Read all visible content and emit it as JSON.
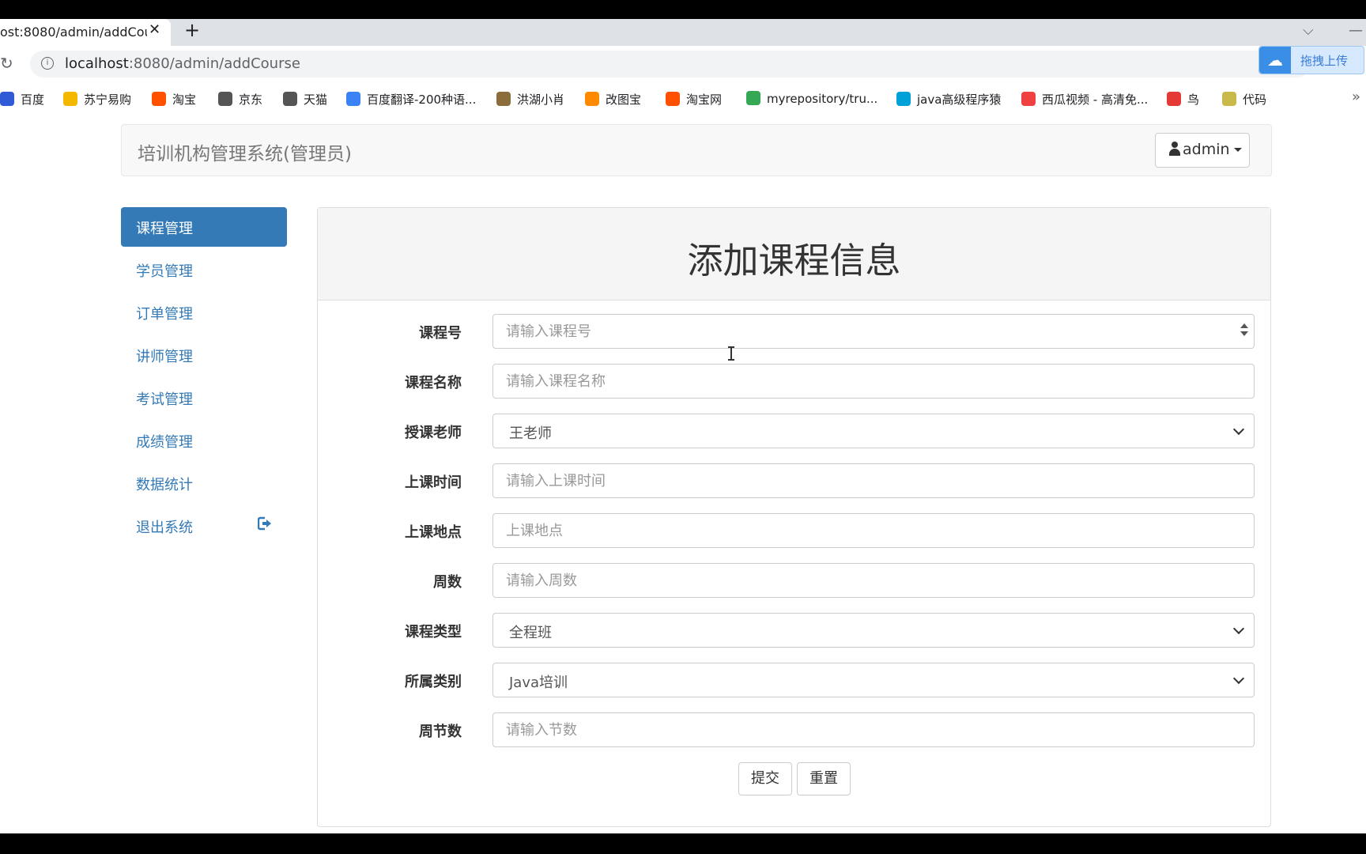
{
  "browser": {
    "tab_title": "ost:8080/admin/addCou",
    "url_host": "localhost",
    "url_rest": ":8080/admin/addCourse",
    "upload_label": "拖拽上传",
    "bookmarks": [
      {
        "label": "百度",
        "icon": "baidu-paw-icon",
        "color": "#2f5bd6"
      },
      {
        "label": "苏宁易购",
        "icon": "suning-lion-icon",
        "color": "#f5b800"
      },
      {
        "label": "淘宝",
        "icon": "taobao-icon",
        "color": "#ff5000"
      },
      {
        "label": "京东",
        "icon": "globe-icon",
        "color": "#555555"
      },
      {
        "label": "天猫",
        "icon": "globe-icon",
        "color": "#555555"
      },
      {
        "label": "百度翻译-200种语...",
        "icon": "translate-icon",
        "color": "#3b82f6"
      },
      {
        "label": "洪湖小肖",
        "icon": "bird-icon",
        "color": "#8a6d3b"
      },
      {
        "label": "改图宝",
        "icon": "gaitubao-icon",
        "color": "#ff8a00"
      },
      {
        "label": "淘宝网",
        "icon": "taobao-icon",
        "color": "#ff5000"
      },
      {
        "label": "myrepository/tru...",
        "icon": "chrome-icon",
        "color": "#34a853"
      },
      {
        "label": "java高级程序猿",
        "icon": "bilibili-icon",
        "color": "#00a1d6"
      },
      {
        "label": "西瓜视频 - 高清免...",
        "icon": "xigua-icon",
        "color": "#f04142"
      },
      {
        "label": "鸟",
        "icon": "bird-red-icon",
        "color": "#e53935"
      },
      {
        "label": "代码",
        "icon": "code-icon",
        "color": "#c9b84a"
      }
    ],
    "more": "»"
  },
  "navbar": {
    "brand": "培训机构管理系统(管理员)",
    "user": "admin"
  },
  "sidebar": {
    "items": [
      {
        "label": "课程管理",
        "active": true
      },
      {
        "label": "学员管理"
      },
      {
        "label": "订单管理"
      },
      {
        "label": "讲师管理"
      },
      {
        "label": "考试管理"
      },
      {
        "label": "成绩管理"
      },
      {
        "label": "数据统计"
      },
      {
        "label": "退出系统"
      }
    ]
  },
  "form": {
    "title": "添加课程信息",
    "course_no": {
      "label": "课程号",
      "placeholder": "请输入课程号"
    },
    "course_name": {
      "label": "课程名称",
      "placeholder": "请输入课程名称"
    },
    "teacher": {
      "label": "授课老师",
      "value": "王老师"
    },
    "time": {
      "label": "上课时间",
      "placeholder": "请输入上课时间"
    },
    "location": {
      "label": "上课地点",
      "placeholder": "上课地点"
    },
    "weeks": {
      "label": "周数",
      "placeholder": "请输入周数"
    },
    "course_type": {
      "label": "课程类型",
      "value": "全程班"
    },
    "category": {
      "label": "所属类别",
      "value": "Java培训"
    },
    "sessions": {
      "label": "周节数",
      "placeholder": "请输入节数"
    },
    "submit": "提交",
    "reset": "重置"
  }
}
